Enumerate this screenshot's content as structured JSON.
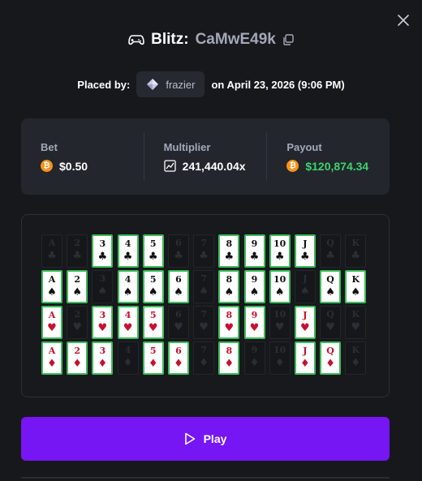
{
  "header": {
    "game_name": "Blitz:",
    "game_id": "CaMwE49k"
  },
  "placed": {
    "prefix": "Placed by:",
    "user": "frazier",
    "date": "on April 23, 2026 (9:06 PM)"
  },
  "stats": {
    "bet_label": "Bet",
    "bet_value": "$0.50",
    "multiplier_label": "Multiplier",
    "multiplier_value": "241,440.04x",
    "payout_label": "Payout",
    "payout_value": "$120,874.34"
  },
  "cards": {
    "ranks": [
      "A",
      "2",
      "3",
      "4",
      "5",
      "6",
      "7",
      "8",
      "9",
      "10",
      "J",
      "Q",
      "K"
    ],
    "rows": [
      {
        "suit": "♣",
        "color": "black",
        "selected": [
          false,
          false,
          true,
          true,
          true,
          false,
          false,
          true,
          true,
          true,
          true,
          false,
          false
        ]
      },
      {
        "suit": "♠",
        "color": "black",
        "selected": [
          true,
          true,
          false,
          true,
          true,
          true,
          false,
          true,
          true,
          true,
          false,
          true,
          true
        ]
      },
      {
        "suit": "♥",
        "color": "red",
        "selected": [
          true,
          false,
          true,
          true,
          true,
          false,
          false,
          true,
          true,
          false,
          true,
          false,
          false
        ]
      },
      {
        "suit": "♦",
        "color": "red",
        "selected": [
          true,
          true,
          true,
          false,
          true,
          true,
          false,
          true,
          false,
          false,
          true,
          true,
          false
        ]
      }
    ]
  },
  "play_label": "Play",
  "colors": {
    "accent": "#7716f4",
    "selected_border": "#3bbd5a",
    "payout": "#3dd26b",
    "coin": "#f7931a"
  }
}
